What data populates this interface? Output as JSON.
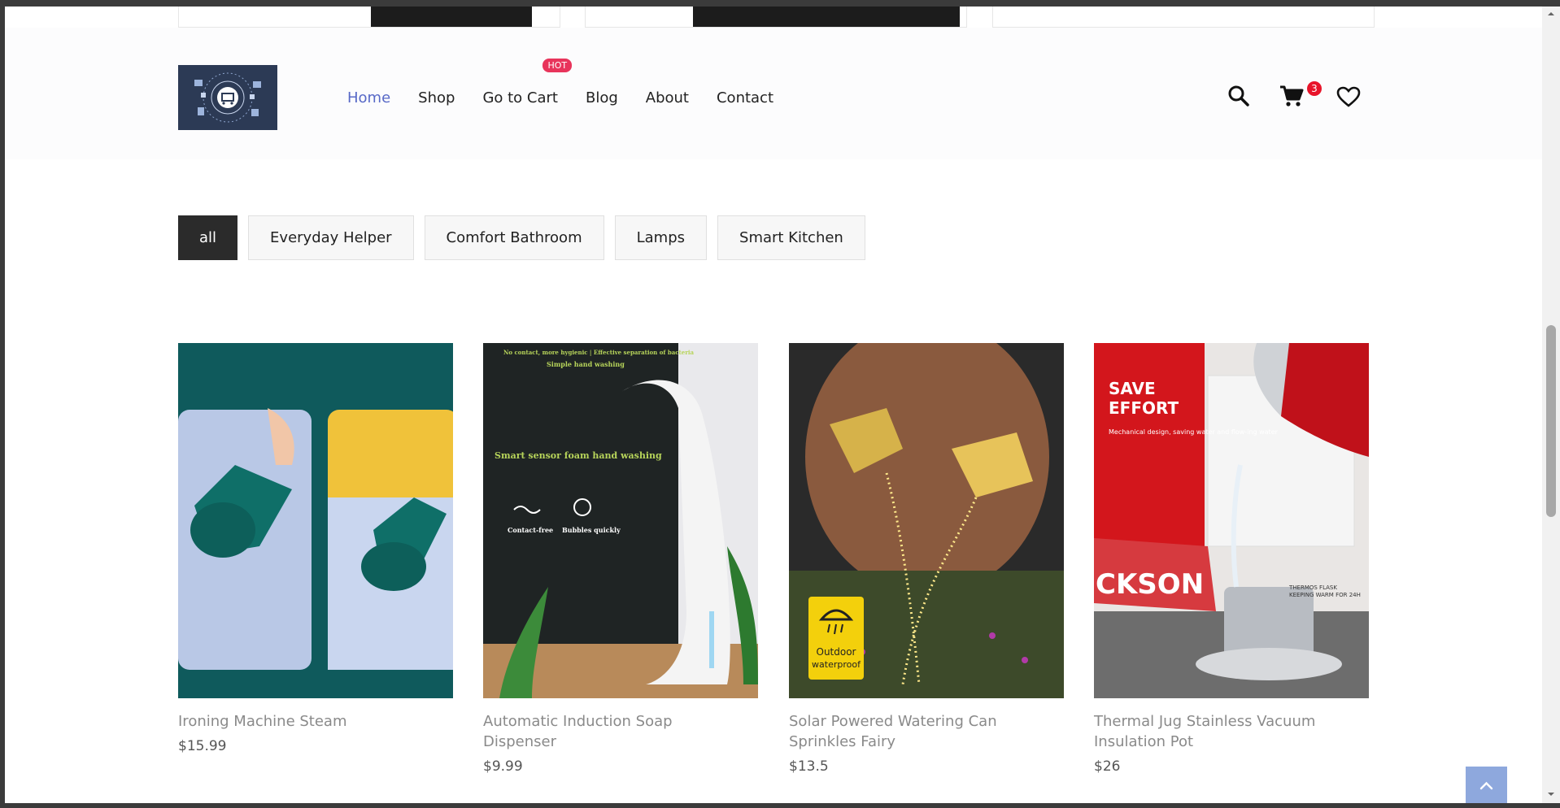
{
  "nav": {
    "items": [
      {
        "label": "Home",
        "active": true
      },
      {
        "label": "Shop",
        "active": false
      },
      {
        "label": "Go to Cart",
        "active": false,
        "badge": "HOT"
      },
      {
        "label": "Blog",
        "active": false
      },
      {
        "label": "About",
        "active": false
      },
      {
        "label": "Contact",
        "active": false
      }
    ]
  },
  "header_icons": {
    "search": "search-icon",
    "cart": "cart-icon",
    "cart_count": "3",
    "wishlist": "heart-icon"
  },
  "filters": [
    {
      "label": "all",
      "active": true
    },
    {
      "label": "Everyday Helper",
      "active": false
    },
    {
      "label": "Comfort Bathroom",
      "active": false
    },
    {
      "label": "Lamps",
      "active": false
    },
    {
      "label": "Smart Kitchen",
      "active": false
    }
  ],
  "products": [
    {
      "name": "Ironing Machine Steam",
      "price": "$15.99"
    },
    {
      "name": "Automatic Induction Soap Dispenser",
      "price": "$9.99",
      "image_text": {
        "top1": "No contact, more hygienic | Effective separation of bacteria",
        "top2": "Simple hand washing",
        "mid": "Smart sensor foam hand washing",
        "f1": "Contact-free",
        "f2": "Bubbles quickly"
      }
    },
    {
      "name": "Solar Powered Watering Can Sprinkles Fairy",
      "price": "$13.5",
      "image_text": {
        "badge1": "Outdoor",
        "badge2": "waterproof"
      }
    },
    {
      "name": "Thermal Jug Stainless Vacuum Insulation Pot",
      "price": "$26",
      "image_text": {
        "title1": "SAVE",
        "title2": "EFFORT",
        "desc": "Mechanical design, saving water and flow-ing water",
        "book": "CKSON",
        "caption1": "THERMOS FLASK",
        "caption2": "KEEPING WARM FOR 24H"
      }
    }
  ],
  "colors": {
    "accent_nav": "#5869c7",
    "hot_badge": "#e8345b",
    "cart_badge": "#e8142a",
    "filter_active": "#2b2b2b",
    "scroll_top": "#8ea8dd"
  }
}
